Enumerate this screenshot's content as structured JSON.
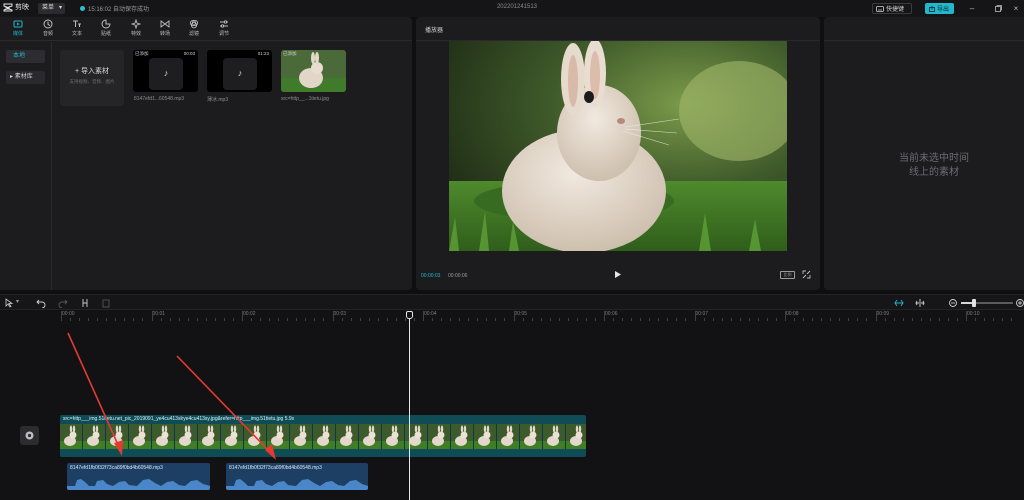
{
  "app": {
    "name": "剪映",
    "menu_label": "菜单",
    "save_status": "15:16:02 自动保存成功",
    "project_title": "202201241513",
    "shortcut_label": "快捷键",
    "export_label": "导出"
  },
  "toolbar": {
    "items": [
      {
        "label": "媒体",
        "icon": "media-icon"
      },
      {
        "label": "音频",
        "icon": "audio-icon"
      },
      {
        "label": "文本",
        "icon": "text-icon"
      },
      {
        "label": "贴纸",
        "icon": "sticker-icon"
      },
      {
        "label": "特效",
        "icon": "effects-icon"
      },
      {
        "label": "转场",
        "icon": "transition-icon"
      },
      {
        "label": "滤镜",
        "icon": "filter-icon"
      },
      {
        "label": "调节",
        "icon": "adjust-icon"
      }
    ]
  },
  "side_nav": {
    "local": "本地",
    "library": "素材库"
  },
  "media": {
    "import_label": "导入素材",
    "import_hint": "支持视频、音频、图片",
    "added_tag": "已添加",
    "items": [
      {
        "name": "8147efd1...60548.mp3",
        "duration": "00:03",
        "type": "audio"
      },
      {
        "name": "薄冰.mp3",
        "duration": "01:23",
        "type": "audio"
      },
      {
        "name": "src=http__...1tietu.jpg",
        "duration": "",
        "type": "image"
      }
    ]
  },
  "player": {
    "title": "播放器",
    "current_time": "00:00:03",
    "total_time": "00:00:06",
    "ratio_label": "比例"
  },
  "properties": {
    "empty_line1": "当前未选中时间",
    "empty_line2": "线上的素材"
  },
  "timeline": {
    "ruler_labels": [
      "00:00",
      "00:01",
      "00:02",
      "00:03",
      "00:04",
      "00:05",
      "00:06",
      "00:07",
      "00:08",
      "00:09",
      "00:10"
    ],
    "video_clip_label": "src=http___img.51tietu.net_pic_2019091_ye4cu413slrye4cu413sy.jpg&refer=http___img.51tietu.jpg   5.9s",
    "audio_clips": [
      {
        "label": "8147efd1fb0f32f73ca89f0bd4b60548.mp3"
      },
      {
        "label": "8147efd1fb0f32f73ca89f0bd4b60548.mp3"
      }
    ]
  },
  "colors": {
    "accent": "#22b7cc",
    "video_track": "#0f4c56",
    "audio_track": "#1d3f63",
    "annotation_arrow": "#e53a32"
  }
}
